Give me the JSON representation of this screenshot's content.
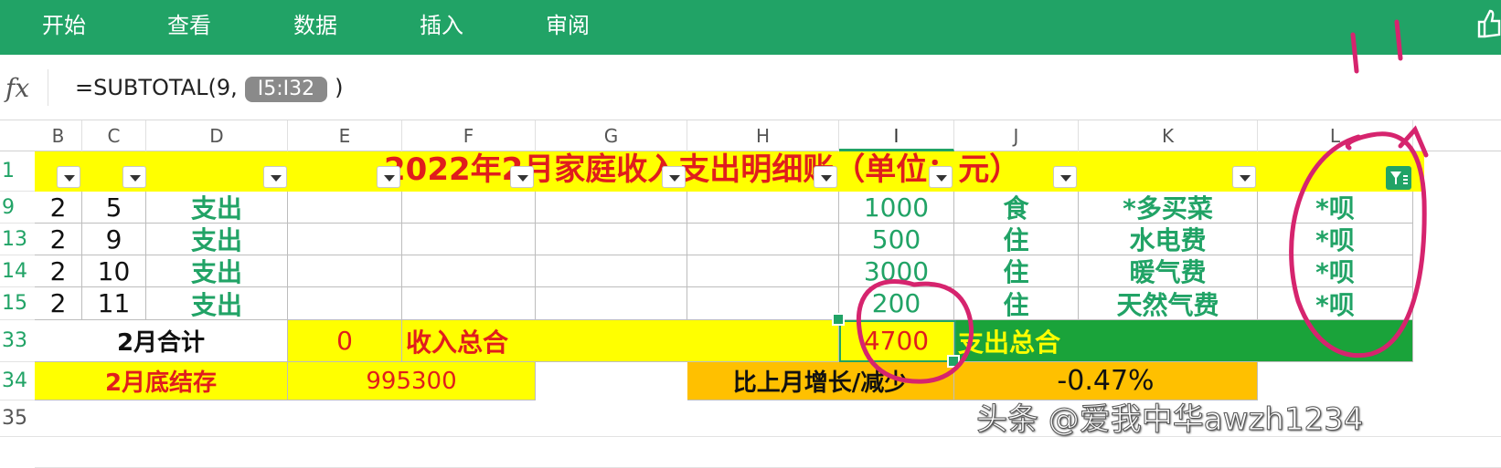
{
  "ribbon": {
    "menu": [
      "开始",
      "查看",
      "数据",
      "插入",
      "审阅"
    ]
  },
  "formula_bar": {
    "fx_label": "fx",
    "formula_prefix": "=SUBTOTAL(9,",
    "range_ref": "I5:I32",
    "formula_suffix": ")"
  },
  "columns": [
    "B",
    "C",
    "D",
    "E",
    "F",
    "G",
    "H",
    "I",
    "J",
    "K",
    "L"
  ],
  "rows": {
    "header_numbers": [
      "1",
      "9",
      "13",
      "14",
      "15",
      "33",
      "34",
      "35"
    ]
  },
  "title": "2022年2月家庭收入支出明细账（单位：元）",
  "expense_rows": [
    {
      "b": "2",
      "c": "5",
      "d": "支出",
      "i": "1000",
      "j": "食",
      "k": "*多买菜",
      "l": "*呗"
    },
    {
      "b": "2",
      "c": "9",
      "d": "支出",
      "i": "500",
      "j": "住",
      "k": "水电费",
      "l": "*呗"
    },
    {
      "b": "2",
      "c": "10",
      "d": "支出",
      "i": "3000",
      "j": "住",
      "k": "暖气费",
      "l": "*呗"
    },
    {
      "b": "2",
      "c": "11",
      "d": "支出",
      "i": "200",
      "j": "住",
      "k": "天然气费",
      "l": "*呗"
    }
  ],
  "summary": {
    "month_total_label": "2月合计",
    "income_total_value": "0",
    "income_total_label": "收入总合",
    "expense_total_value": "4700",
    "expense_total_label": "支出总合",
    "month_end_balance_label": "2月底结存",
    "month_end_balance_value": "995300",
    "change_label": "比上月增长/减少",
    "change_value": "-0.47%"
  },
  "annotation": {
    "text": "11"
  },
  "watermark": "头条 @爱我中华awzh1234",
  "colors": {
    "ribbon": "#21a366",
    "title_bg": "#ffff00",
    "title_text": "#e01d1d",
    "expense_green": "#21a366",
    "orange_bg": "#ffc000",
    "dark_green_bg": "#1aa33a",
    "annotation_pen": "#d6246e"
  }
}
